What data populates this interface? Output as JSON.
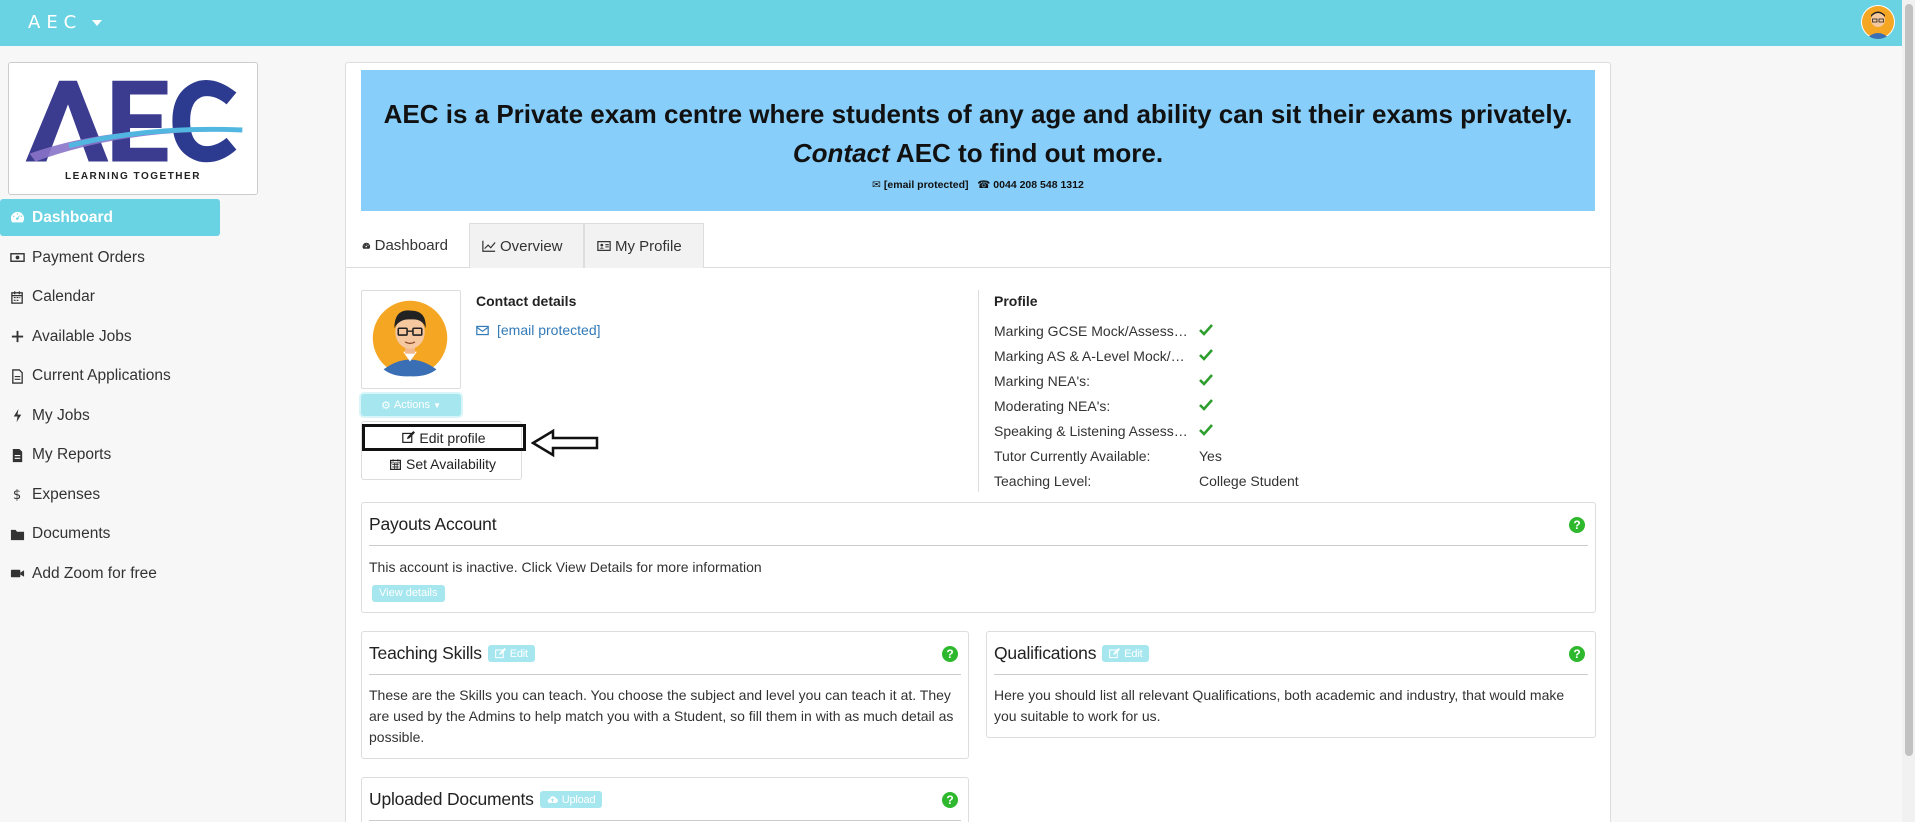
{
  "header": {
    "brand": "AEC"
  },
  "logo": {
    "tagline": "LEARNING TOGETHER"
  },
  "sidebar": {
    "items": [
      {
        "label": "Dashboard",
        "icon": "dashboard-icon",
        "active": true
      },
      {
        "label": "Payment Orders",
        "icon": "money-icon"
      },
      {
        "label": "Calendar",
        "icon": "calendar-icon"
      },
      {
        "label": "Available Jobs",
        "icon": "plus-icon"
      },
      {
        "label": "Current Applications",
        "icon": "file-icon"
      },
      {
        "label": "My Jobs",
        "icon": "bolt-icon"
      },
      {
        "label": "My Reports",
        "icon": "file-text-icon"
      },
      {
        "label": "Expenses",
        "icon": "dollar-icon"
      },
      {
        "label": "Documents",
        "icon": "folder-icon"
      },
      {
        "label": "Add Zoom for free",
        "icon": "video-icon"
      }
    ]
  },
  "banner": {
    "line1": "AEC is a Private exam centre where students of any age and ability can sit their exams privately.",
    "line2_em": "Contact",
    "line2_rest": " AEC to find out more.",
    "email": "[email protected]",
    "phone": "0044 208 548 1312"
  },
  "tabs": [
    {
      "label": "Dashboard",
      "icon": "dashboard-icon"
    },
    {
      "label": "Overview",
      "icon": "line-chart-icon"
    },
    {
      "label": "My Profile",
      "icon": "id-card-icon"
    }
  ],
  "actions": {
    "label": "Actions",
    "menu": [
      {
        "label": "Edit profile",
        "icon": "edit-icon"
      },
      {
        "label": "Set Availability",
        "icon": "calendar-icon"
      }
    ]
  },
  "contact": {
    "title": "Contact details",
    "email": "[email protected]"
  },
  "profile": {
    "title": "Profile",
    "rows": [
      {
        "key": "Marking GCSE Mock/Assessments:",
        "check": true
      },
      {
        "key": "Marking AS & A-Level Mock/Assessments:",
        "check": true
      },
      {
        "key": "Marking NEA's:",
        "check": true
      },
      {
        "key": "Moderating NEA's:",
        "check": true
      },
      {
        "key": "Speaking & Listening Assessments:",
        "check": true
      },
      {
        "key": "Tutor Currently Available:",
        "value": "Yes"
      },
      {
        "key": "Teaching Level:",
        "value": "College Student"
      }
    ]
  },
  "payouts": {
    "title": "Payouts Account",
    "text": "This account is inactive. Click View Details for more information",
    "button": "View details"
  },
  "teaching": {
    "title": "Teaching Skills",
    "button": "Edit",
    "text": "These are the Skills you can teach. You choose the subject and level you can teach it at. They are used by the Admins to help match you with a Student, so fill them in with as much detail as possible."
  },
  "qualifications": {
    "title": "Qualifications",
    "button": "Edit",
    "text": "Here you should list all relevant Qualifications, both academic and industry, that would make you suitable to work for us."
  },
  "uploads": {
    "title": "Uploaded Documents",
    "button": "Upload"
  },
  "colors": {
    "topbar": "#69d3e3",
    "banner": "#87cefa",
    "check": "#2e9e2e",
    "help": "#2eb82e"
  }
}
